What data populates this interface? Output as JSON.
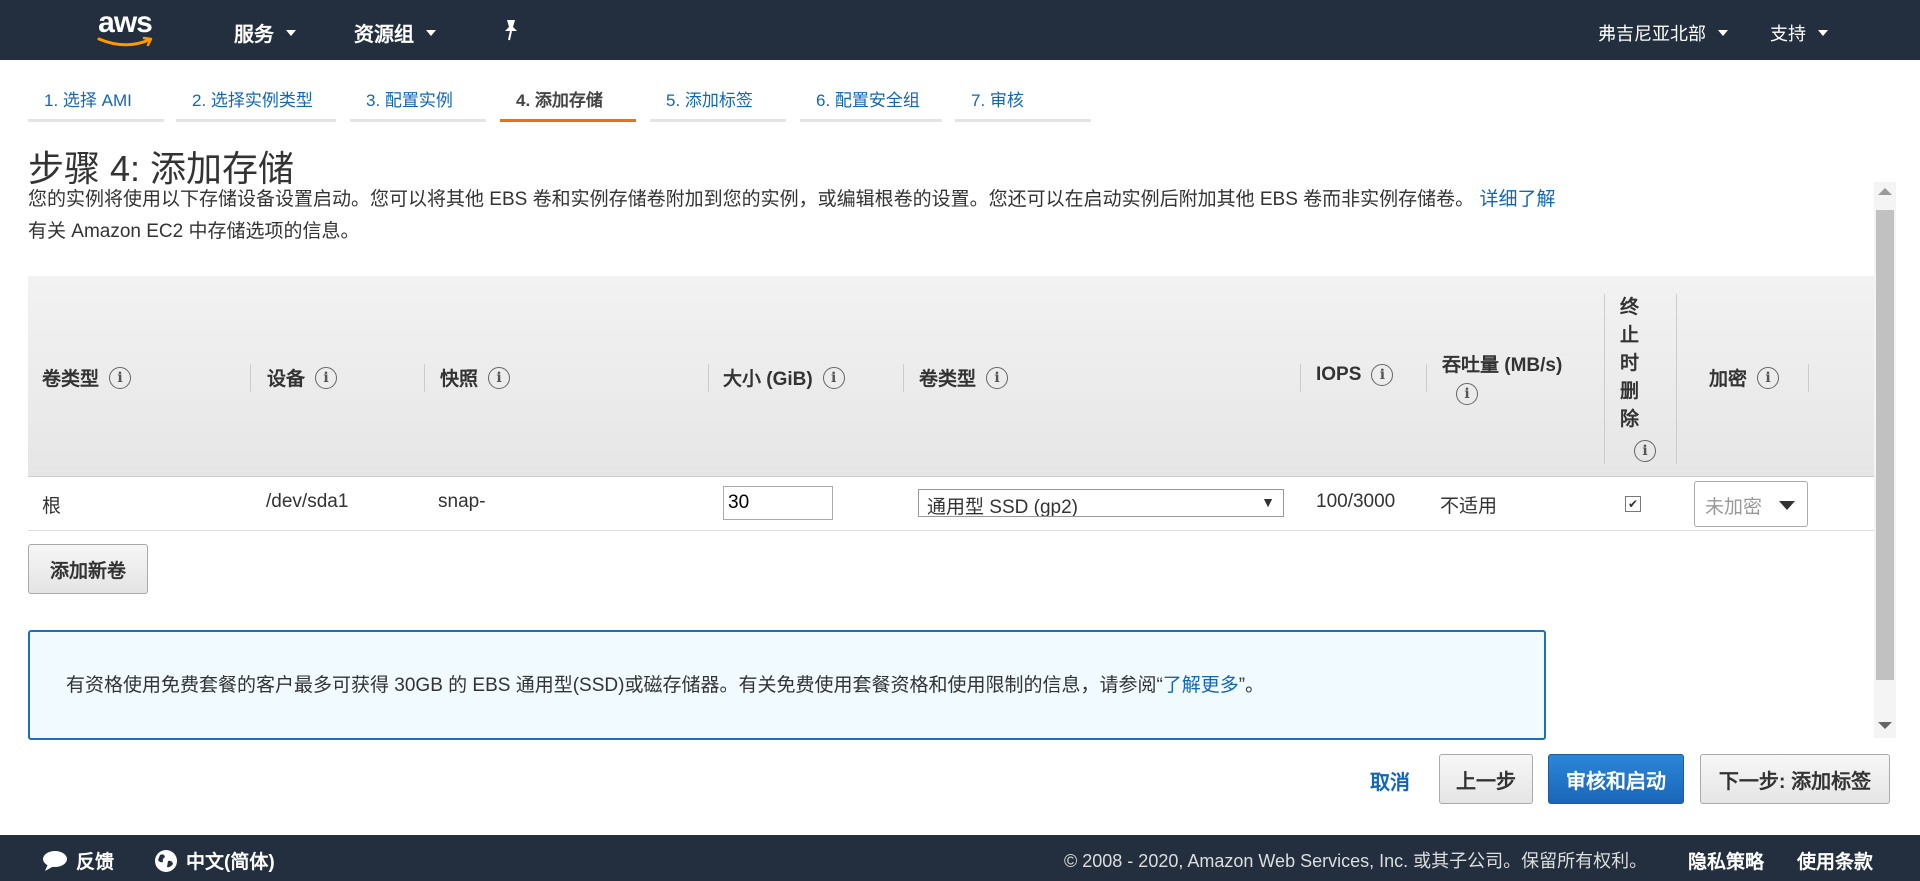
{
  "topnav": {
    "logo_text": "aws",
    "services": "服务",
    "resource_groups": "资源组",
    "region": "弗吉尼亚北部",
    "support": "支持"
  },
  "steps": [
    "1. 选择 AMI",
    "2. 选择实例类型",
    "3. 配置实例",
    "4. 添加存储",
    "5. 添加标签",
    "6. 配置安全组",
    "7. 审核"
  ],
  "page": {
    "title": "步骤 4: 添加存储",
    "desc_part1": "您的实例将使用以下存储设备设置启动。您可以将其他 EBS 卷和实例存储卷附加到您的实例，或编辑根卷的设置。您还可以在启动实例后附加其他 EBS 卷而非实例存储卷。",
    "desc_link": "详细了解",
    "desc_part2": " 有关 Amazon EC2 中存储选项的信息。"
  },
  "table": {
    "headers": {
      "volume_type": "卷类型",
      "device": "设备",
      "snapshot": "快照",
      "size": "大小 (GiB)",
      "vol_type": "卷类型",
      "iops": "IOPS",
      "throughput": "吞吐量 (MB/s)",
      "delete_on_termination": "终止时删除",
      "encryption": "加密"
    },
    "row": {
      "volume_type": "根",
      "device": "/dev/sda1",
      "snapshot": "snap-",
      "size": "30",
      "vol_type": "通用型 SSD (gp2)",
      "iops": "100/3000",
      "throughput": "不适用",
      "delete_on_termination": true,
      "encryption": "未加密"
    },
    "add_volume_button": "添加新卷"
  },
  "info_box": {
    "text_before": "有资格使用免费套餐的客户最多可获得 30GB 的 EBS 通用型(SSD)或磁存储器。有关免费使用套餐资格和使用限制的信息，请参阅“",
    "link": "了解更多",
    "text_after": "”。"
  },
  "actions": {
    "cancel": "取消",
    "previous": "上一步",
    "review_launch": "审核和启动",
    "next": "下一步: 添加标签"
  },
  "footer": {
    "feedback": "反馈",
    "language": "中文(简体)",
    "copyright": "© 2008 - 2020, Amazon Web Services, Inc. 或其子公司。保留所有权利。",
    "privacy": "隐私策略",
    "terms": "使用条款"
  },
  "colors": {
    "nav_bg": "#232f3e",
    "link": "#1166bb",
    "active_step": "#ec7211",
    "primary_button": "#1a66b8"
  }
}
